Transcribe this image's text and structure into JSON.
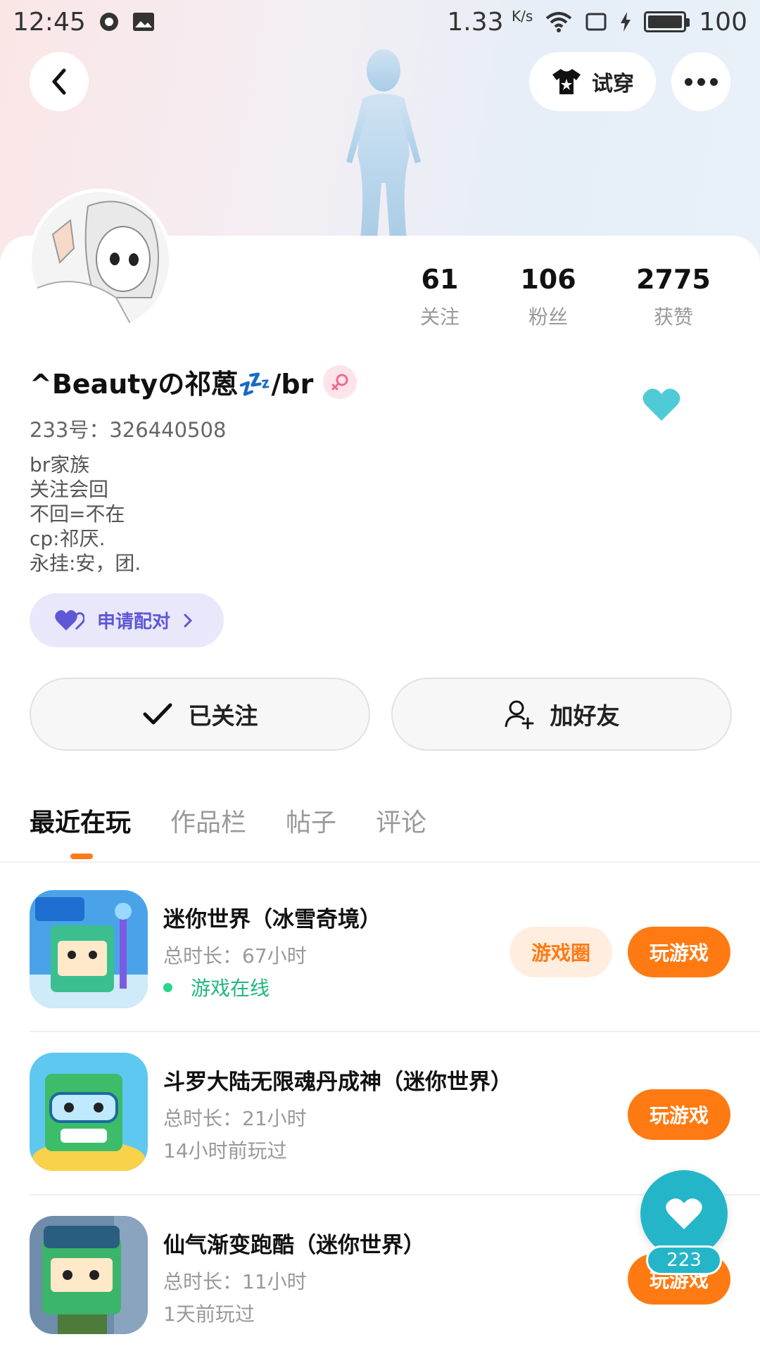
{
  "status_bar": {
    "time": "12:45",
    "net_speed": "1.33",
    "net_unit": "K/s",
    "battery": "100"
  },
  "header": {
    "tryon_label": "试穿"
  },
  "profile": {
    "name": "^Beautyの祁蒽💤/br",
    "uid": "233号：326440508",
    "bio": [
      "br家族",
      "关注会回",
      "不回=不在",
      "cp:祁厌.",
      "永挂:安，团."
    ],
    "stats": [
      {
        "value": "61",
        "label": "关注"
      },
      {
        "value": "106",
        "label": "粉丝"
      },
      {
        "value": "2775",
        "label": "获赞"
      }
    ],
    "pair_label": "申请配对",
    "follow_label": "已关注",
    "add_friend_label": "加好友"
  },
  "tabs": [
    {
      "label": "最近在玩",
      "active": true
    },
    {
      "label": "作品栏",
      "active": false
    },
    {
      "label": "帖子",
      "active": false
    },
    {
      "label": "评论",
      "active": false
    }
  ],
  "games": [
    {
      "title": "迷你世界（冰雪奇境）",
      "duration": "总时长：67小时",
      "status": "游戏在线",
      "community_label": "游戏圈",
      "play_label": "玩游戏"
    },
    {
      "title": "斗罗大陆无限魂丹成神（迷你世界）",
      "duration": "总时长：21小时",
      "status": "14小时前玩过",
      "play_label": "玩游戏"
    },
    {
      "title": "仙气渐变跑酷（迷你世界）",
      "duration": "总时长：11小时",
      "status": "1天前玩过",
      "play_label": "玩游戏"
    }
  ],
  "fab": {
    "count": "223"
  },
  "colors": {
    "accent": "#ff7a12",
    "teal": "#24b6c8",
    "online": "#1fb87c",
    "pair": "#5e57d6"
  }
}
